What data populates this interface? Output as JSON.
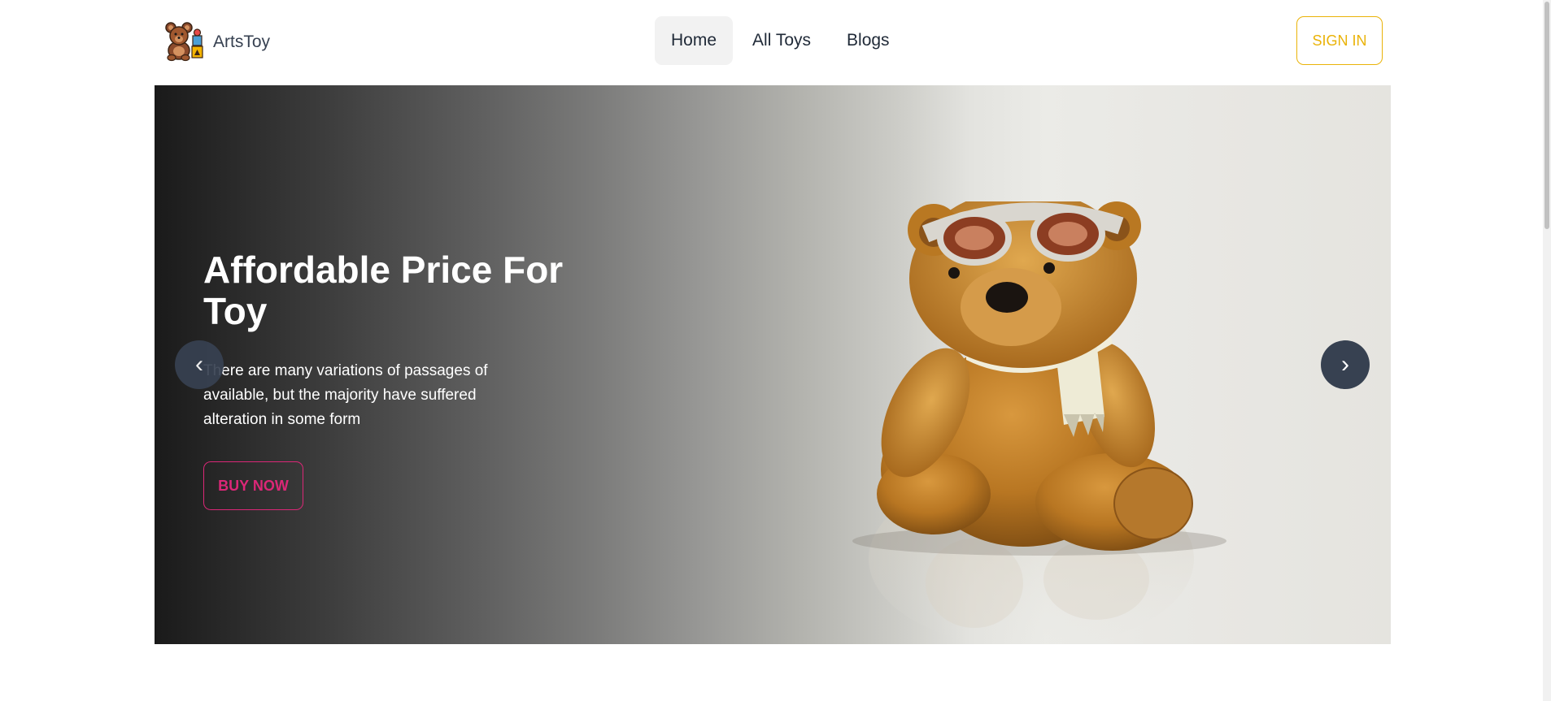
{
  "brand": {
    "name": "ArtsToy",
    "logo_icon": "teddy-bear-with-blocks-icon"
  },
  "nav": {
    "items": [
      {
        "label": "Home",
        "active": true
      },
      {
        "label": "All Toys",
        "active": false
      },
      {
        "label": "Blogs",
        "active": false
      }
    ],
    "signin_label": "SIGN IN"
  },
  "hero": {
    "title": "Affordable Price For Toy",
    "description": "There are many variations of passages of available, but the majority have suffered alteration in some form",
    "button_label": "BUY NOW",
    "prev_icon": "‹",
    "next_icon": "›",
    "image": "teddy-bear-with-aviator-goggles-and-scarf"
  },
  "colors": {
    "accent_yellow": "#eab308",
    "accent_pink": "#db2777",
    "arrow_bg": "#374151"
  }
}
